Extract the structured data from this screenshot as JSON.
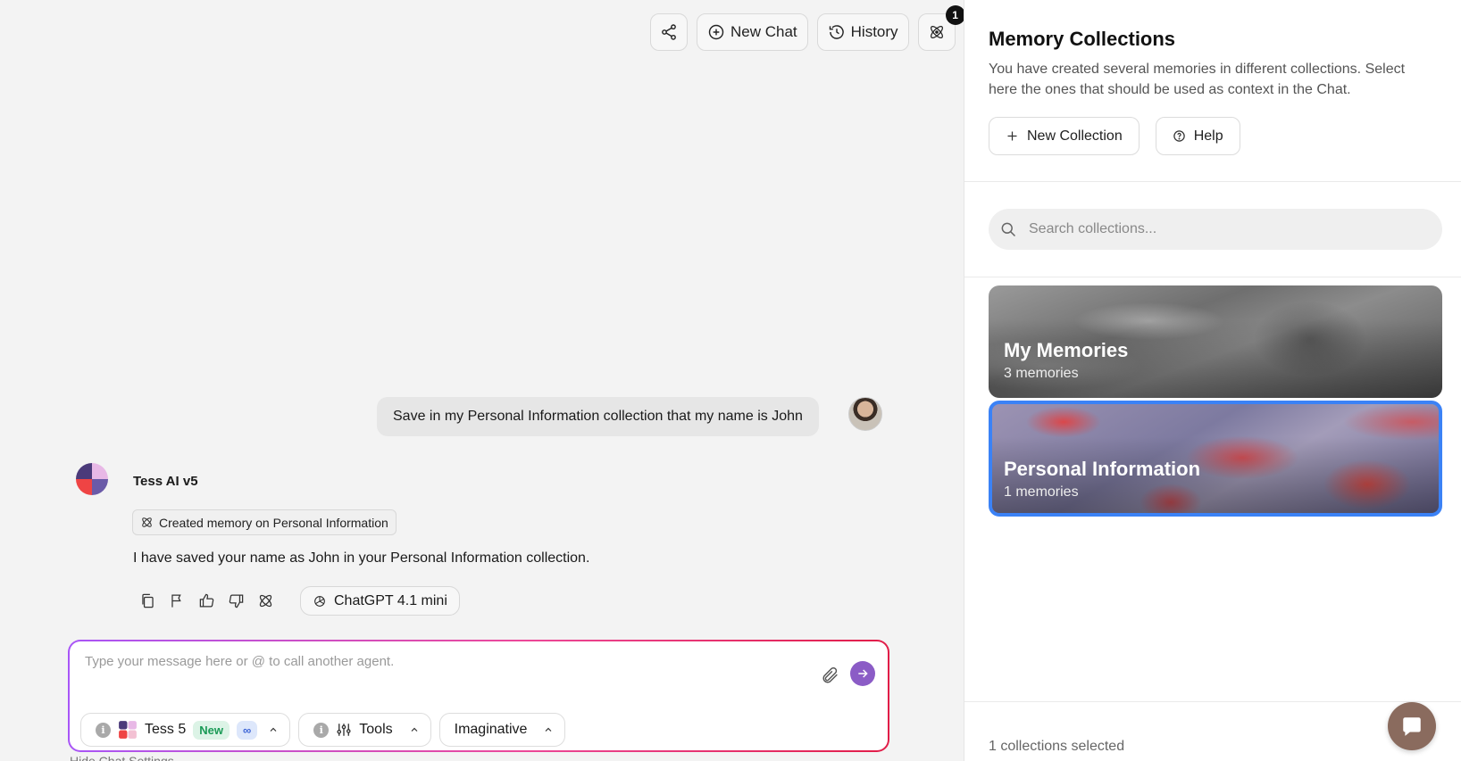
{
  "topbar": {
    "share_icon": "share-icon",
    "new_chat_label": "New Chat",
    "history_label": "History",
    "memory_badge": "1"
  },
  "conversation": {
    "user_message": "Save in my Personal Information collection that my name is John",
    "agent_name": "Tess AI v5",
    "memory_tag": "Created memory on Personal Information",
    "agent_reply": "I have saved your name as John in your Personal Information collection.",
    "model_label": "ChatGPT 4.1 mini"
  },
  "composer": {
    "placeholder": "Type your message here or @ to call another agent.",
    "agent_label": "Tess 5",
    "new_badge": "New",
    "infinity_badge": "∞",
    "tools_label": "Tools",
    "mode_label": "Imaginative",
    "hide_settings": "Hide Chat Settings"
  },
  "panel": {
    "title": "Memory Collections",
    "description": "You have created several memories in different collections. Select here the ones that should be used as context in the Chat.",
    "new_collection_label": "New Collection",
    "help_label": "Help",
    "search_placeholder": "Search collections...",
    "collections": [
      {
        "name": "My Memories",
        "count": "3 memories",
        "selected": false
      },
      {
        "name": "Personal Information",
        "count": "1 memories",
        "selected": true
      }
    ],
    "footer": "1 collections selected"
  },
  "colors": {
    "accent_purple": "#8b5cc6",
    "selected_border": "#3b82f6",
    "chat_fab": "#8a6b5e"
  }
}
